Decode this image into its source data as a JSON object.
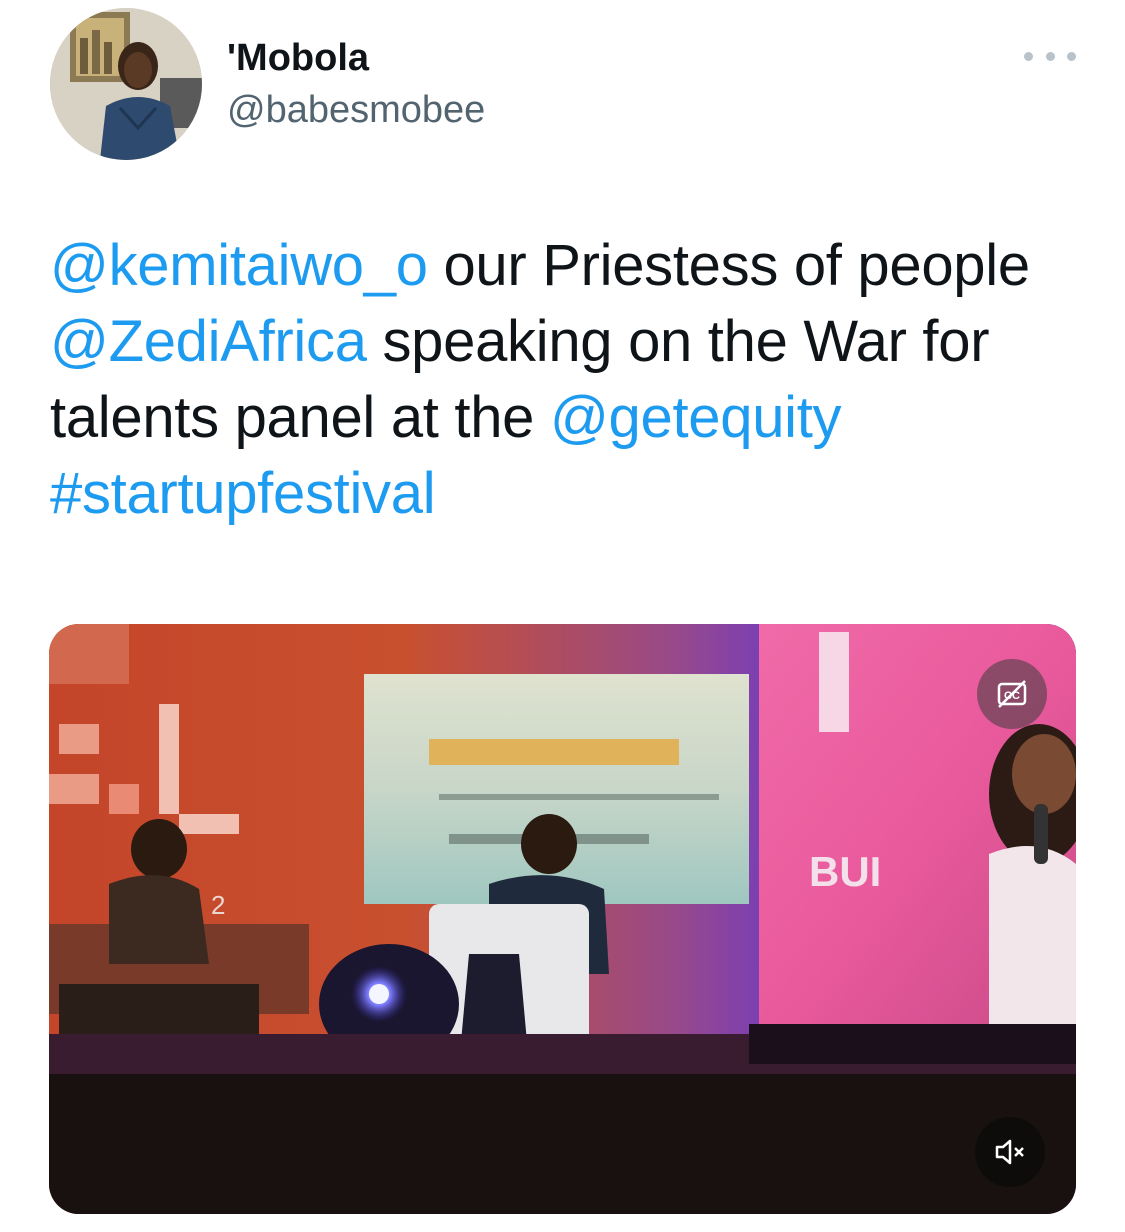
{
  "author": {
    "display_name": "'Mobola",
    "handle": "@babesmobee",
    "avatar_icon": "profile-photo"
  },
  "tweet": {
    "segments": [
      {
        "text": "@kemitaiwo_o",
        "type": "mention"
      },
      {
        "text": " our Priestess of people ",
        "type": "text"
      },
      {
        "text": "@ZediAfrica",
        "type": "mention"
      },
      {
        "text": " speaking on the War for talents panel at the ",
        "type": "text"
      },
      {
        "text": "@getequity",
        "type": "mention"
      },
      {
        "text": " ",
        "type": "text"
      },
      {
        "text": "#startupfestival",
        "type": "hashtag"
      }
    ]
  },
  "media": {
    "type": "video",
    "screen_text": "BUI",
    "backdrop_text": "2",
    "captions_icon": "closed-captions-off-icon",
    "volume_icon": "volume-muted-icon"
  },
  "colors": {
    "link": "#1d9bf0",
    "text": "#0f1419",
    "secondary": "#536471"
  }
}
